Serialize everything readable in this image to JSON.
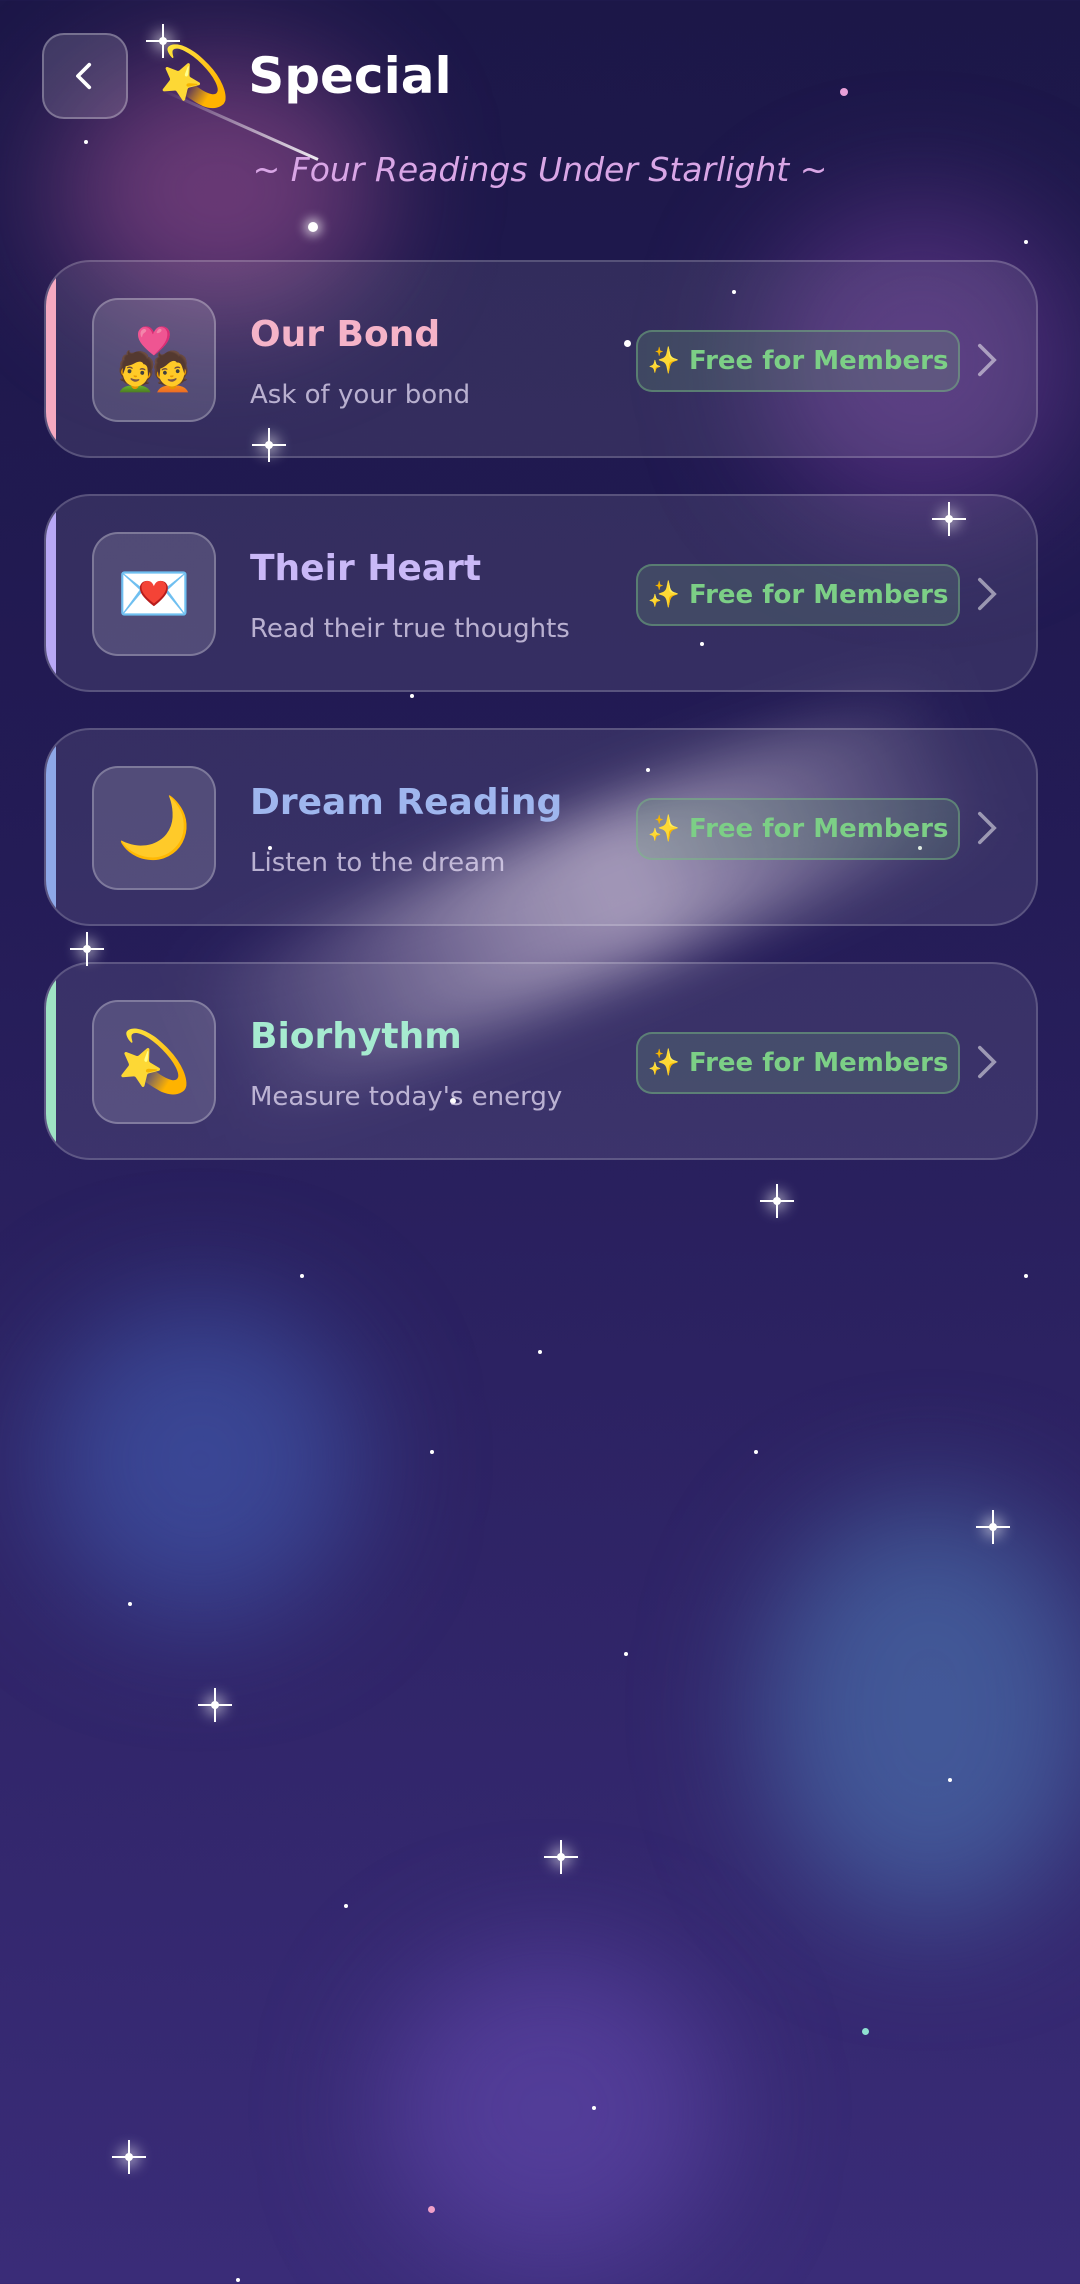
{
  "header": {
    "back_icon": "chevron-left-icon",
    "title_emoji": "💫",
    "title": "Special",
    "subtitle": "~ Four Readings Under Starlight ~"
  },
  "cards": [
    {
      "icon": "💑",
      "title": "Our Bond",
      "desc": "Ask of your bond",
      "badge": "✨ Free for Members",
      "accent": "#f5a9c0",
      "title_color": "#f5b3c8"
    },
    {
      "icon": "💌",
      "title": "Their Heart",
      "desc": "Read their true thoughts",
      "badge": "✨ Free for Members",
      "accent": "#b8a8f5",
      "title_color": "#c9b8f7"
    },
    {
      "icon": "🌙",
      "title": "Dream Reading",
      "desc": "Listen to the dream",
      "badge": "✨ Free for Members",
      "accent": "#8ea8e8",
      "title_color": "#9fb6ee"
    },
    {
      "icon": "💫",
      "title": "Biorhythm",
      "desc": "Measure today's energy",
      "badge": "✨ Free for Members",
      "accent": "#9fe3c4",
      "title_color": "#a6ebd0"
    }
  ]
}
